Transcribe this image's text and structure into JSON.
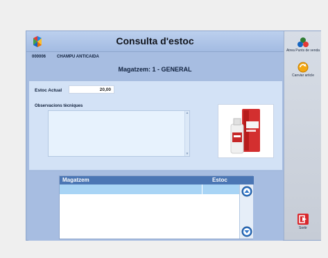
{
  "window": {
    "title": "Consulta d'estoc"
  },
  "product": {
    "code": "000006",
    "description": "CHAMPU ANTICAIDA"
  },
  "warehouse_title": "Magatzem: 1 - GENERAL",
  "stock": {
    "label": "Estoc Actual",
    "value": "20,00"
  },
  "observations": {
    "label": "Observacions tècniques",
    "value": ""
  },
  "grid": {
    "columns": [
      "Magatzem",
      "Estoc"
    ],
    "rows": [
      {
        "magatzem": "",
        "estoc": ""
      }
    ]
  },
  "sidebar": {
    "items": [
      {
        "label": "Atrea Punts de venda",
        "icon": "store-points-icon"
      },
      {
        "label": "Canviar article",
        "icon": "change-article-icon"
      },
      {
        "label": "Sortir",
        "icon": "exit-icon"
      }
    ]
  },
  "colors": {
    "header": "#4b76b4",
    "selected_row": "#a8d4f5",
    "exit": "#d9262b"
  }
}
